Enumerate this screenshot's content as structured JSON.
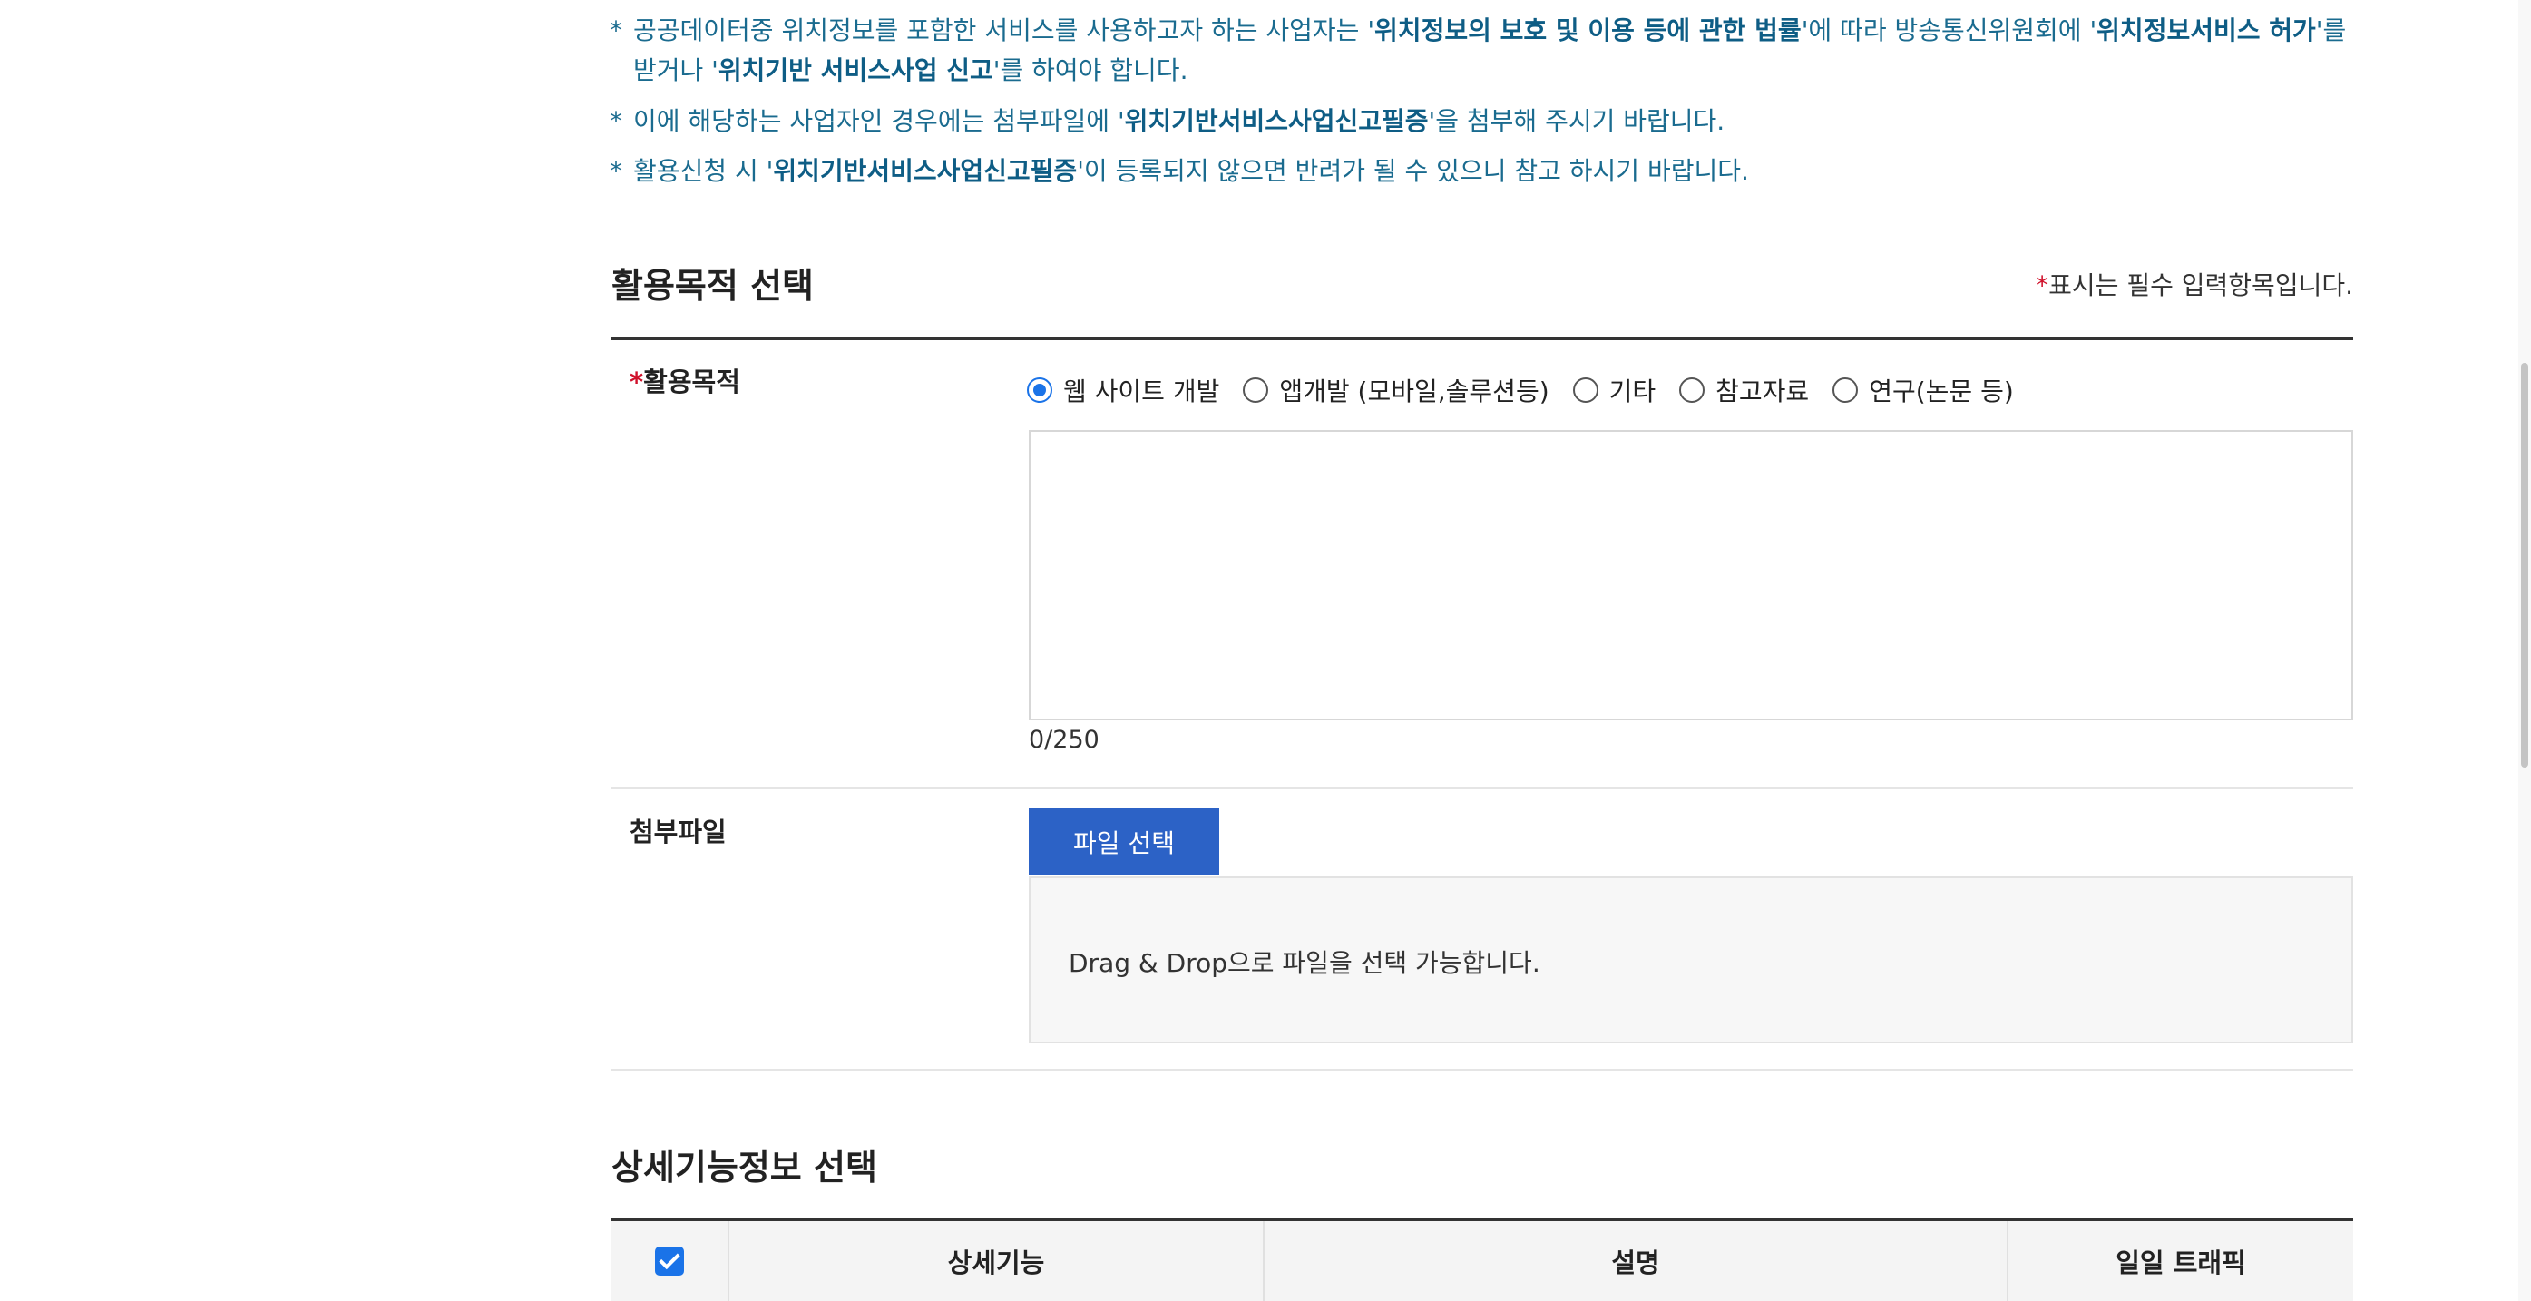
{
  "notices": [
    {
      "marker": "*",
      "parts": [
        {
          "text": " 공공데이터중 위치정보를 포함한 서비스를 사용하고자 하는 사업자는 '",
          "bold": false
        },
        {
          "text": "위치정보의 보호 및 이용 등에 관한 법률",
          "bold": true
        },
        {
          "text": "'에 따라 방송통신위원회에 '",
          "bold": false
        },
        {
          "text": "위치정보서비스 허가",
          "bold": true
        },
        {
          "text": "'를 받거나 '",
          "bold": false
        },
        {
          "text": "위치기반 서비스사업 신고",
          "bold": true
        },
        {
          "text": "'를 하여야 합니다.",
          "bold": false
        }
      ]
    },
    {
      "marker": "*",
      "parts": [
        {
          "text": " 이에 해당하는 사업자인 경우에는 첨부파일에 '",
          "bold": false
        },
        {
          "text": "위치기반서비스사업신고필증",
          "bold": true
        },
        {
          "text": "'을 첨부해 주시기 바랍니다.",
          "bold": false
        }
      ]
    },
    {
      "marker": "*",
      "parts": [
        {
          "text": " 활용신청 시 '",
          "bold": false
        },
        {
          "text": "위치기반서비스사업신고필증",
          "bold": true
        },
        {
          "text": "'이 등록되지 않으면 반려가 될 수 있으니 참고 하시기 바랍니다.",
          "bold": false
        }
      ]
    }
  ],
  "purpose_section": {
    "title": "활용목적 선택",
    "required_marker": "*",
    "required_note": "표시는 필수 입력항목입니다.",
    "field_label": "활용목적",
    "options": [
      {
        "label": "웹 사이트 개발",
        "selected": true
      },
      {
        "label": "앱개발 (모바일,솔루션등)",
        "selected": false
      },
      {
        "label": "기타",
        "selected": false
      },
      {
        "label": "참고자료",
        "selected": false
      },
      {
        "label": "연구(논문 등)",
        "selected": false
      }
    ],
    "textarea_value": "",
    "char_count": "0/250"
  },
  "attachment": {
    "label": "첨부파일",
    "button_label": "파일 선택",
    "drop_hint": "Drag & Drop으로 파일을 선택 가능합니다."
  },
  "detail_section": {
    "title": "상세기능정보 선택",
    "select_all_checked": true,
    "columns": [
      "상세기능",
      "설명",
      "일일 트래픽"
    ]
  },
  "colors": {
    "notice_text": "#1a6b8f",
    "primary_button": "#2c62c6",
    "required_marker": "#d0112b",
    "radio_checked": "#1a73e8"
  }
}
